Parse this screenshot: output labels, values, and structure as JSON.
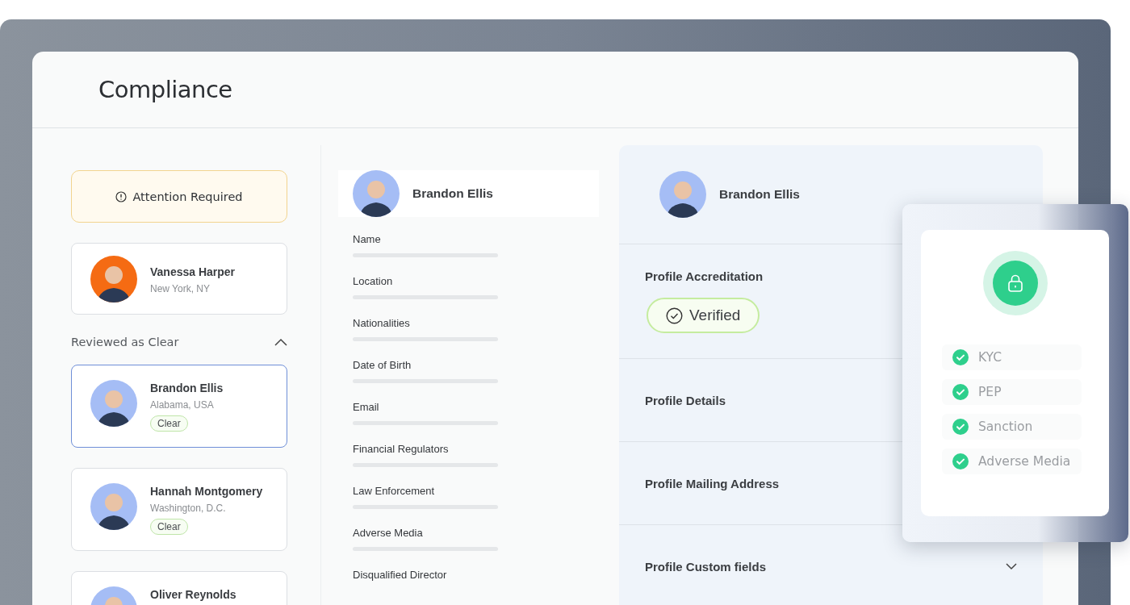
{
  "page": {
    "title": "Compliance"
  },
  "attention": {
    "label": "Attention Required",
    "people": [
      {
        "name": "Vanessa Harper",
        "location": "New York, NY"
      }
    ]
  },
  "reviewed": {
    "label": "Reviewed as Clear",
    "expanded": true,
    "people": [
      {
        "name": "Brandon Ellis",
        "location": "Alabama, USA",
        "badge": "Clear",
        "selected": true
      },
      {
        "name": "Hannah Montgomery",
        "location": "Washington, D.C.",
        "badge": "Clear",
        "selected": false
      },
      {
        "name": "Oliver Reynolds",
        "selected": false
      }
    ]
  },
  "profile": {
    "name": "Brandon Ellis",
    "fields": [
      "Name",
      "Location",
      "Nationalities",
      "Date of Birth",
      "Email",
      "Financial Regulators",
      "Law Enforcement",
      "Adverse Media",
      "Disqualified Director"
    ]
  },
  "details": {
    "name": "Brandon Ellis",
    "sections": [
      {
        "title": "Profile Accreditation",
        "badge": "Verified"
      },
      {
        "title": "Profile Details"
      },
      {
        "title": "Profile Mailing Address"
      },
      {
        "title": "Profile Custom fields",
        "expanded": false
      }
    ]
  },
  "checks": [
    {
      "label": "KYC",
      "checked": true
    },
    {
      "label": "PEP",
      "checked": true
    },
    {
      "label": "Sanction",
      "checked": true
    },
    {
      "label": "Adverse Media",
      "checked": true
    }
  ]
}
